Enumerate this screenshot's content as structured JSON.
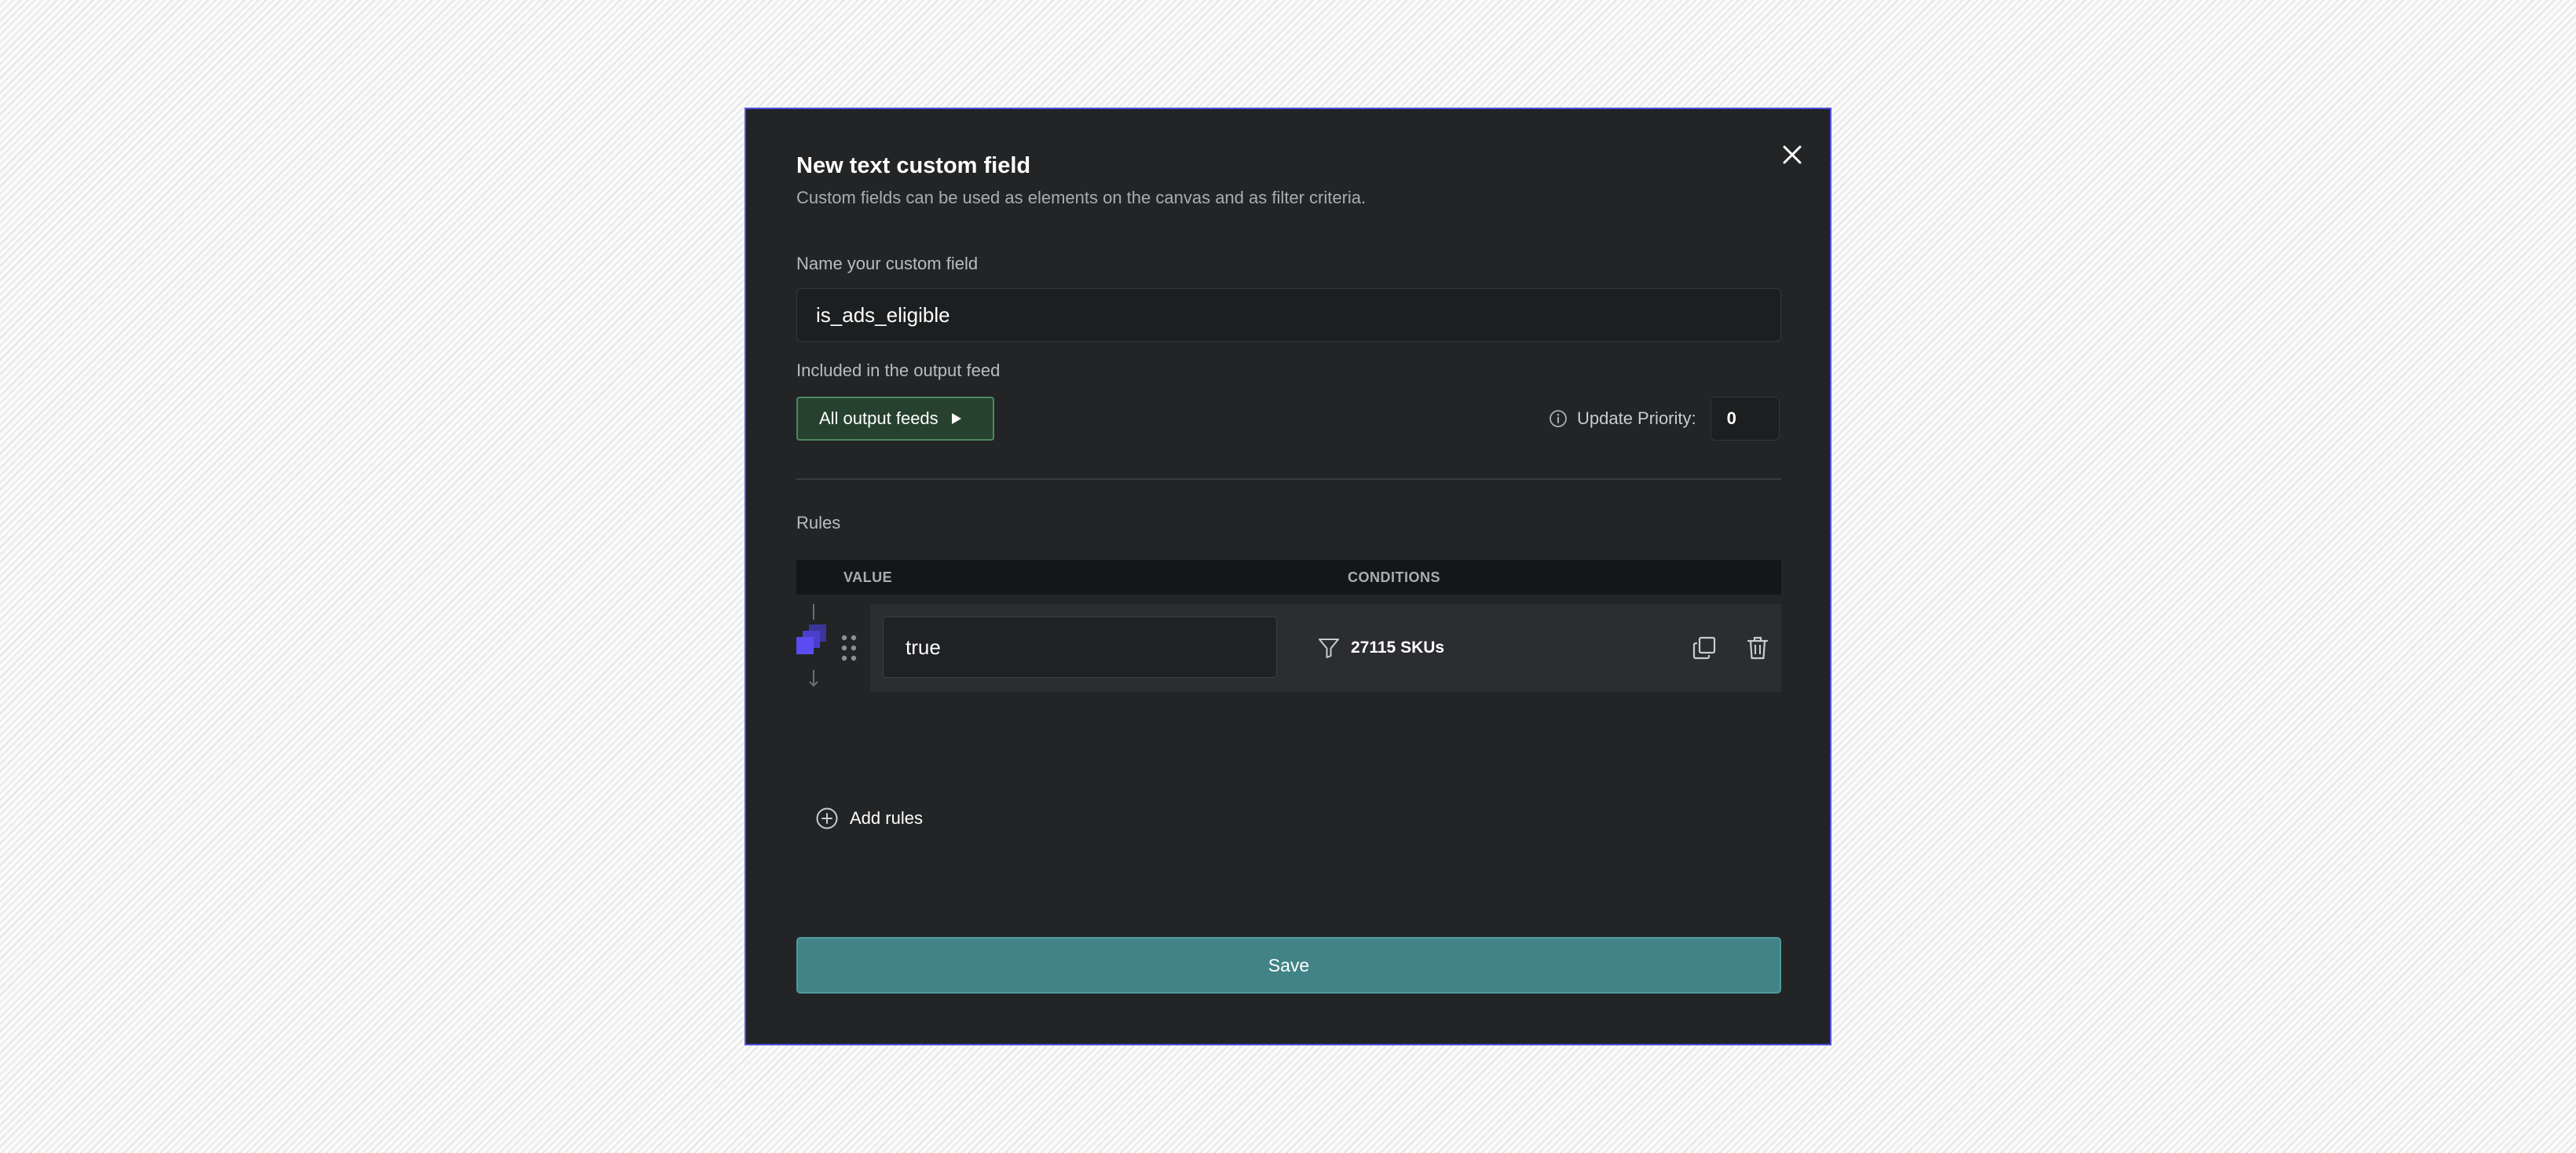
{
  "modal": {
    "title": "New text custom field",
    "subtitle": "Custom fields can be used as elements on the canvas and as filter criteria.",
    "close_icon": "close-icon"
  },
  "name_field": {
    "label": "Name your custom field",
    "value": "is_ads_eligible"
  },
  "output_feed": {
    "label": "Included in the output feed",
    "button_label": "All output feeds",
    "button_icon": "play-triangle-icon"
  },
  "priority": {
    "label": "Update Priority:",
    "value": "0",
    "icon": "info-icon"
  },
  "rules": {
    "label": "Rules",
    "columns": {
      "value": "VALUE",
      "conditions": "CONDITIONS"
    },
    "items": [
      {
        "value": "true",
        "conditions": "27115 SKUs"
      }
    ],
    "add_label": "Add rules"
  },
  "save_label": "Save",
  "colors": {
    "modal_bg": "#222426",
    "modal_border": "#4f4fe0",
    "feed_button_bg": "#26422f",
    "save_button_bg": "#418387",
    "priority_stack_accent": "#5a4cf0"
  }
}
